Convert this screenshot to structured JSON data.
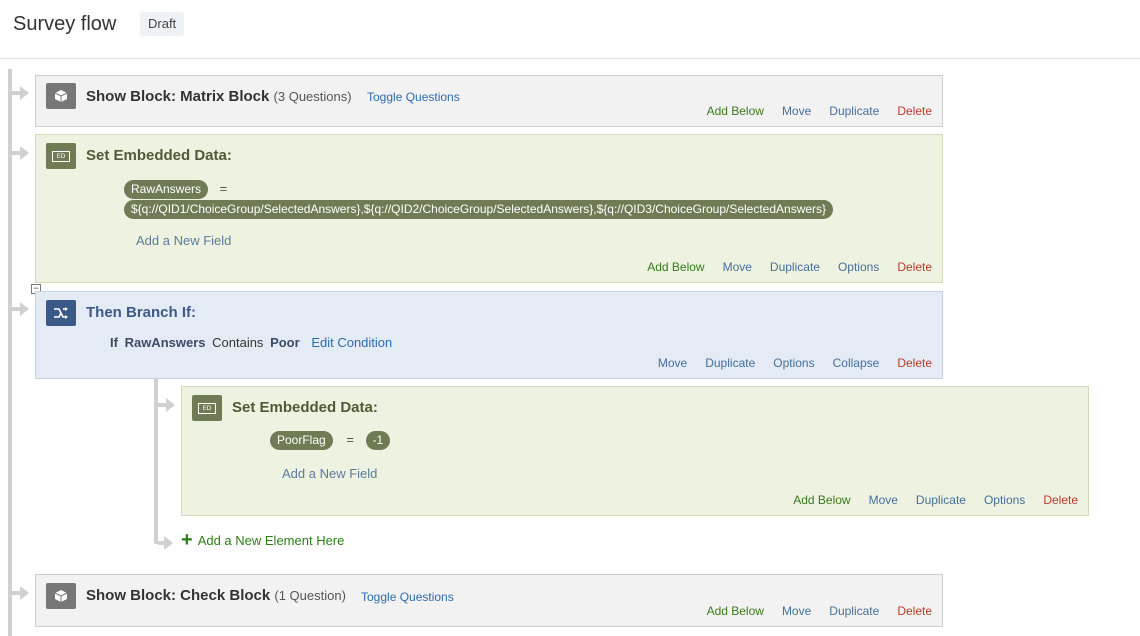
{
  "header": {
    "title": "Survey flow",
    "status": "Draft"
  },
  "elements": {
    "matrix_block": {
      "icon": "cube-icon",
      "title": "Show Block: Matrix Block",
      "subtitle": "(3 Questions)",
      "toggle": "Toggle Questions",
      "actions": {
        "add_below": "Add Below",
        "move": "Move",
        "duplicate": "Duplicate",
        "delete": "Delete"
      }
    },
    "embedded1": {
      "icon_text": "ED",
      "title": "Set Embedded Data:",
      "field_name": "RawAnswers",
      "equals": "=",
      "field_value": "${q://QID1/ChoiceGroup/SelectedAnswers},${q://QID2/ChoiceGroup/SelectedAnswers},${q://QID3/ChoiceGroup/SelectedAnswers}",
      "add_field": "Add a New Field",
      "actions": {
        "add_below": "Add Below",
        "move": "Move",
        "duplicate": "Duplicate",
        "options": "Options",
        "delete": "Delete"
      }
    },
    "branch": {
      "collapse_symbol": "−",
      "icon": "branch-icon",
      "title": "Then Branch If:",
      "cond_if": "If",
      "cond_field": "RawAnswers",
      "cond_op": "Contains",
      "cond_value": "Poor",
      "edit_condition": "Edit Condition",
      "actions": {
        "move": "Move",
        "duplicate": "Duplicate",
        "options": "Options",
        "collapse": "Collapse",
        "delete": "Delete"
      }
    },
    "embedded2": {
      "icon_text": "ED",
      "title": "Set Embedded Data:",
      "field_name": "PoorFlag",
      "equals": "=",
      "field_value": "-1",
      "add_field": "Add a New Field",
      "actions": {
        "add_below": "Add Below",
        "move": "Move",
        "duplicate": "Duplicate",
        "options": "Options",
        "delete": "Delete"
      }
    },
    "add_new_element": {
      "plus": "+",
      "label": "Add a New Element Here"
    },
    "check_block": {
      "icon": "cube-icon",
      "title": "Show Block: Check Block",
      "subtitle": "(1 Question)",
      "toggle": "Toggle Questions",
      "actions": {
        "add_below": "Add Below",
        "move": "Move",
        "duplicate": "Duplicate",
        "delete": "Delete"
      }
    }
  },
  "colors": {
    "block_bg": "#f2f2f2",
    "embedded_bg": "#edf2e1",
    "branch_bg": "#e4ebf4",
    "pill": "#6f7b55",
    "link_blue": "#2b6cb0",
    "green": "#3b7a1b",
    "red": "#c0392b"
  }
}
